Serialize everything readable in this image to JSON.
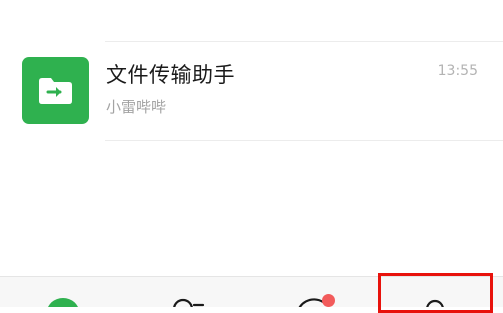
{
  "chat_list": {
    "items": [
      {
        "name": "文件传输助手",
        "preview": "小雷哔哔",
        "time": "13:55",
        "avatar_icon": "folder-arrow-icon",
        "avatar_color": "#2fb14f"
      }
    ]
  },
  "bottom_tabs": [
    {
      "icon": "chats-icon",
      "active": true,
      "color": "#2fb14f"
    },
    {
      "icon": "contacts-icon",
      "active": false
    },
    {
      "icon": "discover-icon",
      "active": false,
      "badge": "red-dot"
    },
    {
      "icon": "me-icon",
      "active": false,
      "highlighted": true
    }
  ],
  "colors": {
    "accent": "#2fb14f",
    "badge": "#f25b5b",
    "highlight_border": "#e8120c"
  }
}
